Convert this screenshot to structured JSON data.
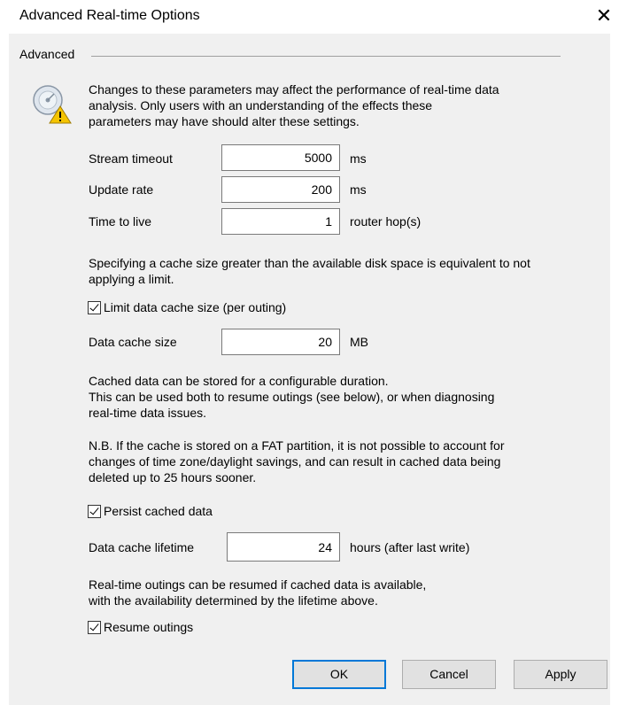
{
  "window": {
    "title": "Advanced Real-time Options",
    "close_glyph": "✕"
  },
  "group": {
    "label": "Advanced"
  },
  "intro_lines": [
    "Changes to these parameters may affect the performance of real-time data",
    "analysis.  Only users with an understanding of the effects these",
    "parameters may have should alter these settings."
  ],
  "fields": {
    "stream_timeout": {
      "label": "Stream timeout",
      "value": "5000",
      "unit": "ms"
    },
    "update_rate": {
      "label": "Update rate",
      "value": "200",
      "unit": "ms"
    },
    "time_to_live": {
      "label": "Time to live",
      "value": "1",
      "unit": "router hop(s)"
    },
    "cache_size": {
      "label": "Data cache size",
      "value": "20",
      "unit": "MB"
    },
    "cache_lifetime": {
      "label": "Data cache lifetime",
      "value": "24",
      "unit": "hours (after last write)"
    }
  },
  "cache_note_lines": [
    "Specifying a cache size greater than the available disk space is equivalent to not",
    "applying a limit."
  ],
  "checkboxes": {
    "limit_cache": {
      "label": "Limit data cache size (per outing)",
      "checked": true
    },
    "persist_cache": {
      "label": "Persist cached data",
      "checked": true
    },
    "resume_outings": {
      "label": "Resume outings",
      "checked": true
    }
  },
  "duration_lines": [
    "Cached data can be stored for a configurable duration.",
    "This can be used both to resume outings (see below), or when diagnosing",
    "real-time data issues."
  ],
  "fat_lines": [
    "N.B. If the cache is stored on a FAT partition, it is not possible to account for",
    "changes of time zone/daylight savings, and can result in cached data being",
    "deleted up to 25 hours sooner."
  ],
  "resume_lines": [
    "Real-time outings can be resumed if cached data is available,",
    "with the availability determined by the lifetime above."
  ],
  "buttons": {
    "ok": "OK",
    "cancel": "Cancel",
    "apply": "Apply"
  },
  "icons": {
    "info": "disk-warning-icon",
    "check": "check-icon"
  },
  "colors": {
    "client_bg": "#f0f0f0",
    "default_border": "#0078d7",
    "warning": "#f5c400"
  }
}
